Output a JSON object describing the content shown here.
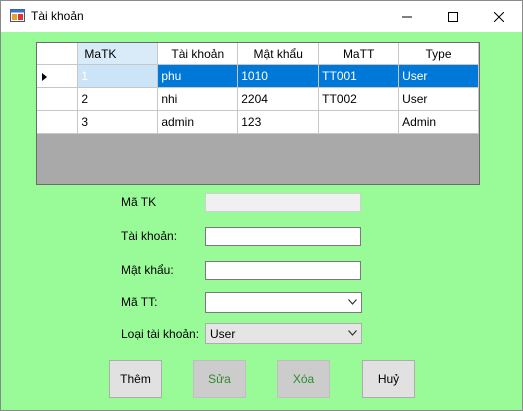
{
  "window": {
    "title": "Tài khoản"
  },
  "grid": {
    "columns": [
      "MaTK",
      "Tài khoản",
      "Mật khẩu",
      "MaTT",
      "Type"
    ],
    "rows": [
      [
        "1",
        "phu",
        "1010",
        "TT001",
        "User"
      ],
      [
        "2",
        "nhi",
        "2204",
        "TT002",
        "User"
      ],
      [
        "3",
        "admin",
        "123",
        "",
        "Admin"
      ]
    ],
    "selected_row": 0
  },
  "form": {
    "matk_label": "Mã TK",
    "matk_value": "",
    "taikhoan_label": "Tài khoản:",
    "taikhoan_value": "",
    "matkhau_label": "Mật khẩu:",
    "matkhau_value": "",
    "matt_label": "Mã TT:",
    "matt_value": "",
    "loai_label": "Loại tài khoản:",
    "loai_value": "User"
  },
  "buttons": {
    "them": "Thêm",
    "sua": "Sửa",
    "xoa": "Xóa",
    "huy": "Huỷ"
  },
  "colors": {
    "form_background": "#98fb98",
    "selection": "#0078d7",
    "grid_empty_area": "#a9a9a9"
  }
}
